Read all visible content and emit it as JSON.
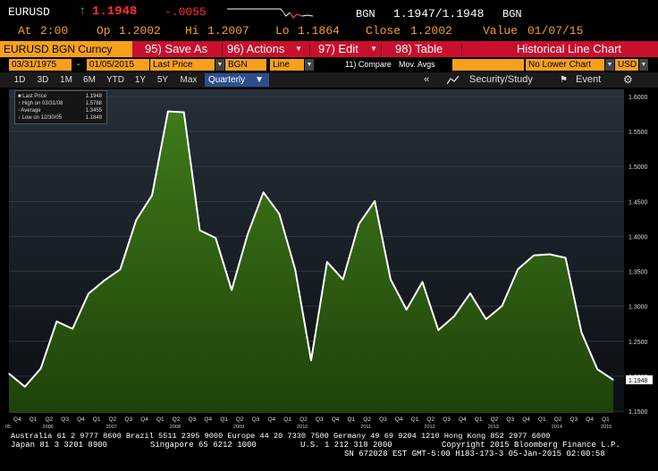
{
  "quote": {
    "ticker": "EURUSD",
    "last": "1.1948",
    "change": "-.0055",
    "source": "BGN",
    "bid_ask": "1.1947/1.1948",
    "source2": "BGN",
    "at_label": "At",
    "at_time": "2:00",
    "open_label": "Op",
    "open": "1.2002",
    "high_label": "Hi",
    "high": "1.2007",
    "low_label": "Lo",
    "low": "1.1864",
    "close_label": "Close",
    "close": "1.2002",
    "value_label": "Value",
    "value_date": "01/07/15",
    "colors": {
      "up": "#3bd43b",
      "last": "#ff3030",
      "label": "#f7a01d"
    }
  },
  "cmdbar": {
    "title": "EURUSD BGN Curncy",
    "save": "95) Save As",
    "actions": "96) Actions",
    "edit": "97) Edit",
    "table": "98) Table",
    "chart_name": "Historical Line Chart"
  },
  "params": {
    "start_date": "03/31/1975",
    "dash": "-",
    "end_date": "01/05/2015",
    "field": "Last Price",
    "source": "BGN",
    "style": "Line",
    "compare": "11) Compare",
    "mov_avgs": "Mov. Avgs",
    "lower_chart": "No Lower Chart",
    "currency": "USD"
  },
  "periods": {
    "items": [
      "1D",
      "3D",
      "1M",
      "6M",
      "YTD",
      "1Y",
      "5Y",
      "Max"
    ],
    "frequency": "Quarterly",
    "collapse": "«",
    "security_study": "Security/Study",
    "event": "Event"
  },
  "legend": {
    "rows": [
      {
        "label": "Last Price",
        "value": "1.1948"
      },
      {
        "label": "High on 03/31/08",
        "value": "1.5788"
      },
      {
        "label": "Average",
        "value": "1.3455"
      },
      {
        "label": "Low on 12/30/05",
        "value": "1.1849"
      }
    ]
  },
  "chart_data": {
    "type": "area",
    "series": [
      {
        "name": "Last Price",
        "values": [
          1.2037,
          1.1849,
          1.211,
          1.2782,
          1.2678,
          1.318,
          1.3369,
          1.3527,
          1.4232,
          1.4589,
          1.5788,
          1.5775,
          1.4088,
          1.3975,
          1.3231,
          1.4021,
          1.4629,
          1.4321,
          1.3525,
          1.2225,
          1.3634,
          1.3384,
          1.4176,
          1.4504,
          1.3385,
          1.2951,
          1.3349,
          1.2658,
          1.2859,
          1.3185,
          1.2815,
          1.3003,
          1.3529,
          1.3727,
          1.3743,
          1.3692,
          1.2628,
          1.2098,
          1.1948
        ]
      }
    ],
    "x_tick_labels": [
      "Q4",
      "Q1",
      "Q2",
      "Q3",
      "Q4",
      "Q1",
      "Q2",
      "Q3",
      "Q4",
      "Q1",
      "Q2",
      "Q3",
      "Q4",
      "Q1",
      "Q2",
      "Q3",
      "Q4",
      "Q1",
      "Q2",
      "Q3",
      "Q4",
      "Q1",
      "Q2",
      "Q3",
      "Q4",
      "Q1",
      "Q2",
      "Q3",
      "Q4",
      "Q1",
      "Q2",
      "Q3",
      "Q4",
      "Q1",
      "Q2",
      "Q3",
      "Q4",
      "Q1"
    ],
    "x_year_labels": [
      {
        "label": "2006",
        "at_index": 2
      },
      {
        "label": "2007",
        "at_index": 6
      },
      {
        "label": "2008",
        "at_index": 10
      },
      {
        "label": "2009",
        "at_index": 14
      },
      {
        "label": "2010",
        "at_index": 18
      },
      {
        "label": "2011",
        "at_index": 22
      },
      {
        "label": "2012",
        "at_index": 26
      },
      {
        "label": "2013",
        "at_index": 30
      },
      {
        "label": "2014",
        "at_index": 34
      },
      {
        "label": "2015",
        "at_index": 38
      }
    ],
    "x_start_label": "05",
    "y_ticks": [
      "1.6000",
      "1.5500",
      "1.5000",
      "1.4500",
      "1.4000",
      "1.3500",
      "1.3000",
      "1.2500",
      "1.2000",
      "1.1500"
    ],
    "ylim": [
      1.15,
      1.6
    ],
    "last_value_label": "1.1948",
    "grid": true,
    "colors": {
      "fill_top": "#3f7a1a",
      "fill_bottom": "#244a0c",
      "line": "#ffffff",
      "bg_top": "#26303a",
      "bg_bottom": "#0b0f13",
      "label_box": "#ffffff"
    }
  },
  "footer": {
    "line1": "Australia 61 2 9777 8600 Brazil 5511 2395 9000 Europe 44 20 7330 7500 Germany 49 69 9204 1210 Hong Kong 852 2977 6000",
    "line2a": "Japan 81 3 3201 8900",
    "line2b": "Singapore 65 6212 1000",
    "line2c": "U.S. 1 212 318 2000",
    "line2d": "Copyright 2015 Bloomberg Finance L.P.",
    "line3": "SN 672028 EST  GMT-5:00 H183-173-3 05-Jan-2015 02:00:58"
  }
}
